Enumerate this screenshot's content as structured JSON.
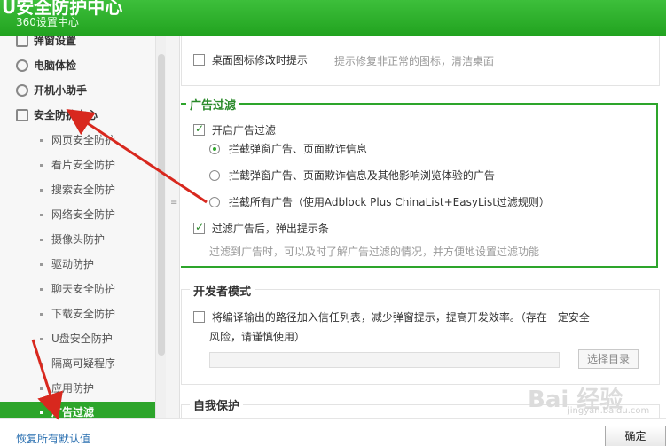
{
  "window": {
    "title": "U安全防护中心",
    "subtitle": "360设置中心"
  },
  "sidebar": {
    "top_items": [
      {
        "label": "弹窗设置",
        "icon": "popup-icon"
      },
      {
        "label": "电脑体检",
        "icon": "checkup-icon"
      },
      {
        "label": "开机小助手",
        "icon": "startup-icon"
      },
      {
        "label": "安全防护中心",
        "icon": "shield-list-icon"
      }
    ],
    "sub_items": [
      {
        "label": "网页安全防护"
      },
      {
        "label": "看片安全防护"
      },
      {
        "label": "搜索安全防护"
      },
      {
        "label": "网络安全防护"
      },
      {
        "label": "摄像头防护"
      },
      {
        "label": "驱动防护"
      },
      {
        "label": "聊天安全防护"
      },
      {
        "label": "下载安全防护"
      },
      {
        "label": "U盘安全防护"
      },
      {
        "label": "隔离可疑程序"
      },
      {
        "label": "应用防护"
      },
      {
        "label": "广告过滤"
      }
    ],
    "active": "广告过滤"
  },
  "main": {
    "desktop_icon": {
      "label": "桌面图标修改时提示",
      "hint": "提示修复非正常的图标，清洁桌面",
      "checked": false
    },
    "ad_filter": {
      "title": "广告过滤",
      "enable": {
        "label": "开启广告过滤",
        "checked": true
      },
      "options": [
        {
          "label": "拦截弹窗广告、页面欺诈信息",
          "selected": true
        },
        {
          "label": "拦截弹窗广告、页面欺诈信息及其他影响浏览体验的广告",
          "selected": false
        },
        {
          "label": "拦截所有广告（使用Adblock Plus ChinaList+EasyList过滤规则）",
          "selected": false
        }
      ],
      "notify": {
        "label": "过滤广告后，弹出提示条",
        "checked": true
      },
      "hint": "过滤到广告时，可以及时了解广告过滤的情况，并方便地设置过滤功能"
    },
    "dev_mode": {
      "title": "开发者模式",
      "trust": {
        "label_line1": "将编译输出的路径加入信任列表，减少弹窗提示，提高开发效率。（存在一定安全",
        "label_line2": "风险，请谨慎使用）",
        "checked": false
      },
      "path_value": "",
      "select_dir_label": "选择目录"
    },
    "self_protect": {
      "title": "自我保护"
    }
  },
  "footer": {
    "restore_label": "恢复所有默认值",
    "ok_label": "确定"
  },
  "watermark": {
    "text": "Bai 经验",
    "sub": "jingyan.baidu.com"
  },
  "colors": {
    "accent": "#2da52b",
    "arrow": "#d8281e",
    "link": "#2a6fb0"
  }
}
